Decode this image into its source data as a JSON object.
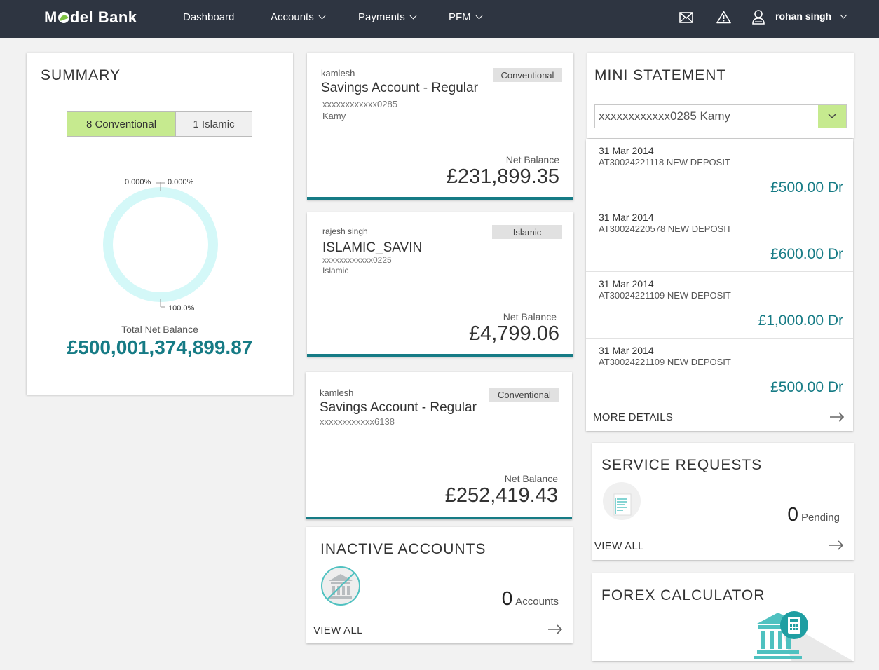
{
  "header": {
    "logo_prefix": "M",
    "logo_suffix": "del Bank",
    "nav": [
      "Dashboard",
      "Accounts",
      "Payments",
      "PFM"
    ],
    "user_name": "rohan singh"
  },
  "summary": {
    "title": "SUMMARY",
    "toggle_conventional": "8 Conventional",
    "toggle_islamic": "1 Islamic",
    "donut_labels": [
      "0.000%",
      "0.000%",
      "100.0%"
    ],
    "total_label": "Total Net Balance",
    "total_value": "£500,001,374,899.87",
    "donut_color": "#d4f8f8"
  },
  "accounts": [
    {
      "owner": "kamlesh",
      "name": "Savings Account - Regular",
      "number": "xxxxxxxxxxxx0285",
      "nickname": "Kamy",
      "badge": "Conventional",
      "balance_label": "Net Balance",
      "balance": "£231,899.35"
    },
    {
      "owner": "rajesh singh",
      "name": "ISLAMIC_SAVIN",
      "number": "xxxxxxxxxxxx0225",
      "nickname": "Islamic",
      "badge": "Islamic",
      "balance_label": "Net Balance",
      "balance": "£4,799.06"
    },
    {
      "owner": "kamlesh",
      "name": "Savings Account - Regular",
      "number": "xxxxxxxxxxxx6138",
      "nickname": "",
      "badge": "Conventional",
      "balance_label": "Net Balance",
      "balance": "£252,419.43"
    }
  ],
  "inactive": {
    "title": "INACTIVE ACCOUNTS",
    "count": "0",
    "count_label": "Accounts",
    "link": "VIEW ALL"
  },
  "mini_statement": {
    "title": "MINI STATEMENT",
    "selected_account": "xxxxxxxxxxxx0285 Kamy",
    "transactions": [
      {
        "date": "31 Mar 2014",
        "desc": "AT30024221118 NEW DEPOSIT",
        "amount": "£500.00 Dr"
      },
      {
        "date": "31 Mar 2014",
        "desc": "AT30024220578 NEW DEPOSIT",
        "amount": "£600.00 Dr"
      },
      {
        "date": "31 Mar 2014",
        "desc": "AT30024221109 NEW DEPOSIT",
        "amount": "£1,000.00 Dr"
      },
      {
        "date": "31 Mar 2014",
        "desc": "AT30024221109 NEW DEPOSIT",
        "amount": "£500.00 Dr"
      }
    ],
    "link": "MORE DETAILS"
  },
  "service_requests": {
    "title": "SERVICE REQUESTS",
    "count": "0",
    "count_label": "Pending",
    "link": "VIEW ALL"
  },
  "forex": {
    "title": "FOREX CALCULATOR"
  },
  "colors": {
    "topbar": "#2e3541",
    "accent_teal": "#167b85",
    "toggle_active": "#c6ea8f",
    "select_button": "#c6ea8f"
  }
}
